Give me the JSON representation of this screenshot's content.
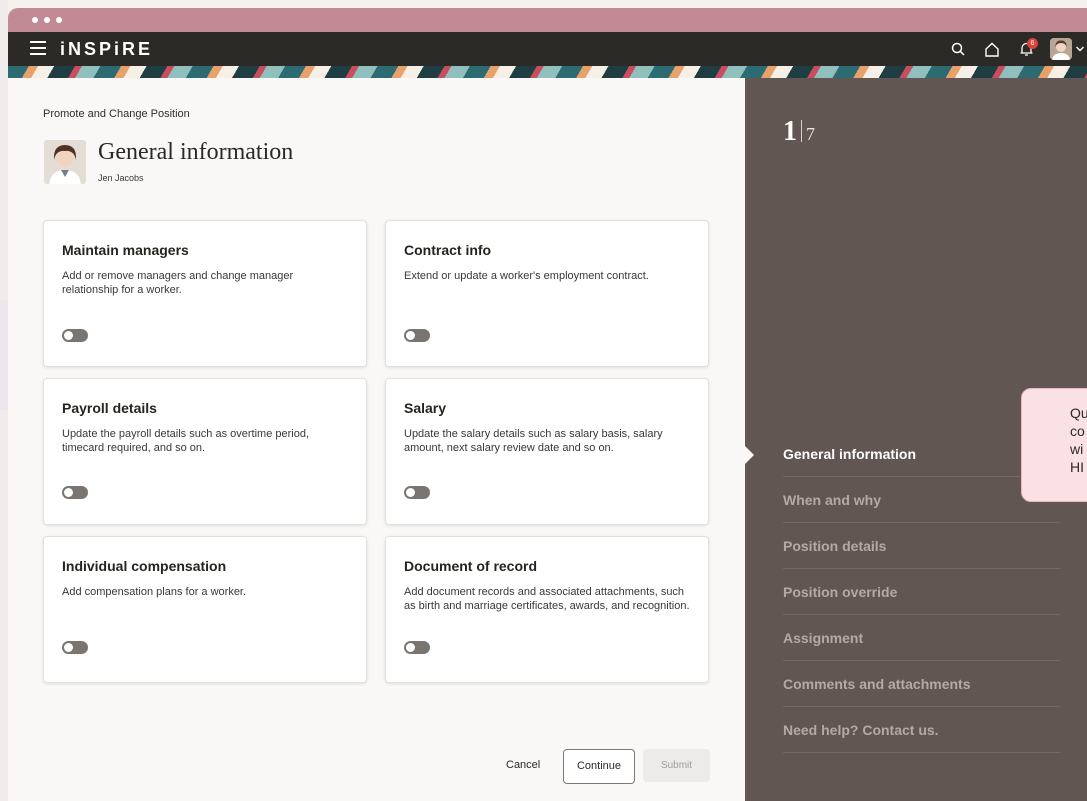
{
  "app": {
    "brand": "iNSPiRE",
    "notification_count": "6"
  },
  "nav_icons": [
    "menu-icon",
    "search-icon",
    "home-icon",
    "bell-icon",
    "avatar"
  ],
  "breadcrumb": "Promote and Change Position",
  "page": {
    "title": "General information",
    "person_name": "Jen Jacobs"
  },
  "cards": [
    {
      "title": "Maintain managers",
      "desc": "Add or remove managers and change manager relationship for a worker.",
      "toggle_on": false
    },
    {
      "title": "Contract info",
      "desc": "Extend or update a worker's employment contract.",
      "toggle_on": false
    },
    {
      "title": "Payroll details",
      "desc": "Update the payroll details such as overtime period, timecard required, and so on.",
      "toggle_on": false
    },
    {
      "title": "Salary",
      "desc": "Update the salary details such as salary basis, salary amount, next salary review date and so on.",
      "toggle_on": false
    },
    {
      "title": "Individual compensation",
      "desc": "Add compensation plans for a worker.",
      "toggle_on": false
    },
    {
      "title": "Document of record",
      "desc": "Add document records and associated attachments, such as birth and marriage certificates, awards, and recognition.",
      "toggle_on": false
    }
  ],
  "actions": {
    "cancel": "Cancel",
    "continue": "Continue",
    "submit": "Submit"
  },
  "progress": {
    "current": "1",
    "total": "7"
  },
  "steps": [
    {
      "label": "General information",
      "active": true
    },
    {
      "label": "When and why",
      "active": false
    },
    {
      "label": "Position details",
      "active": false
    },
    {
      "label": "Position override",
      "active": false
    },
    {
      "label": "Assignment",
      "active": false
    },
    {
      "label": "Comments and attachments",
      "active": false
    },
    {
      "label": "Need help? Contact us.",
      "active": false
    }
  ],
  "tooltip": {
    "lines": [
      "Qu",
      "co",
      "wi",
      "HI"
    ]
  },
  "colors": {
    "titlebar": "#c18a94",
    "navbar": "#2c2a27",
    "side_panel": "#615652",
    "notification_badge": "#d9453a",
    "tooltip_bg": "#fae1e4"
  }
}
